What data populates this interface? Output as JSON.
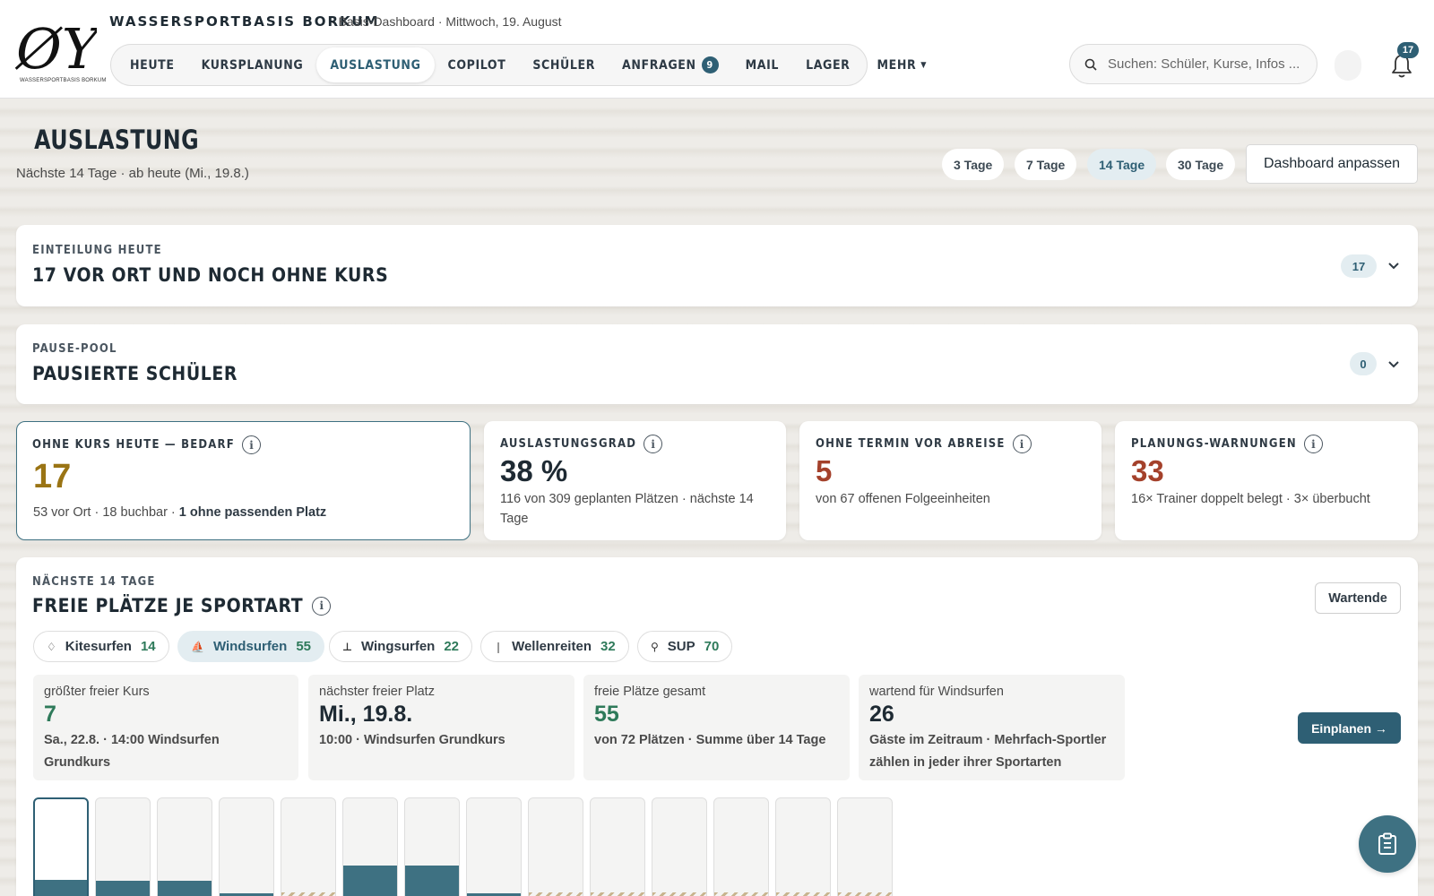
{
  "header": {
    "brand": "WASSERSPORTBASIS BORKUM",
    "subtitle": "· Basis-Dashboard · Mittwoch, 19. August",
    "logo_text": "ØY",
    "logo_subtext": "WASSERSPORTBASIS BORKUM",
    "nav": [
      {
        "label": "HEUTE"
      },
      {
        "label": "KURSPLANUNG"
      },
      {
        "label": "AUSLASTUNG",
        "active": true
      },
      {
        "label": "COPILOT"
      },
      {
        "label": "SCHÜLER"
      },
      {
        "label": "ANFRAGEN",
        "badge": "9"
      },
      {
        "label": "MAIL"
      },
      {
        "label": "LAGER"
      },
      {
        "label": "MEHR"
      }
    ],
    "search_placeholder": "Suchen: Schüler, Kurse, Infos ...",
    "notifications": "17"
  },
  "page": {
    "title": "AUSLASTUNG",
    "subtitle": "Nächste 14 Tage · ab heute (Mi., 19.8.)",
    "ranges": [
      "3 Tage",
      "7 Tage",
      "14 Tage",
      "30 Tage"
    ],
    "active_range": "14 Tage",
    "customize": "Dashboard anpassen"
  },
  "einteilung": {
    "eyebrow": "EINTEILUNG HEUTE",
    "title": "17 VOR ORT UND NOCH OHNE KURS",
    "count": "17"
  },
  "pause_pool": {
    "eyebrow": "PAUSE-POOL",
    "title": "PAUSIERTE SCHÜLER",
    "count": "0"
  },
  "kpis": [
    {
      "label": "OHNE KURS HEUTE — BEDARF",
      "value": "17",
      "color": "#9a7414",
      "desc": "53 vor Ort · 18 buchbar · ",
      "desc_bold": "1 ohne passenden Platz"
    },
    {
      "label": "AUSLASTUNGSGRAD",
      "value": "38 %",
      "color": "#1e2a33",
      "desc": "116 von 309 geplanten Plätzen · nächste 14 Tage"
    },
    {
      "label": "OHNE TERMIN VOR ABREISE",
      "value": "5",
      "color": "#a4412b",
      "desc": "von 67 offenen Folgeeinheiten"
    },
    {
      "label": "PLANUNGS-WARNUNGEN",
      "value": "33",
      "color": "#a4412b",
      "desc": "16× Trainer doppelt belegt · 3× überbucht"
    }
  ],
  "sport": {
    "eyebrow": "NÄCHSTE 14 TAGE",
    "title": "FREIE PLÄTZE JE SPORTART",
    "waiting_button": "Wartende",
    "chips": [
      {
        "label": "Kitesurfen",
        "count": "14",
        "icon": "kite-icon"
      },
      {
        "label": "Windsurfen",
        "count": "55",
        "icon": "windsurf-icon",
        "active": true
      },
      {
        "label": "Wingsurfen",
        "count": "22",
        "icon": "wing-icon"
      },
      {
        "label": "Wellenreiten",
        "count": "32",
        "icon": "surfboard-icon"
      },
      {
        "label": "SUP",
        "count": "70",
        "icon": "sup-icon"
      }
    ],
    "stats": [
      {
        "label": "größter freier Kurs",
        "value": "7",
        "color": "#2e7a5a",
        "desc": "Sa., 22.8. · 14:00 Windsurfen Grundkurs"
      },
      {
        "label": "nächster freier Platz",
        "value": "Mi., 19.8.",
        "color": "#1e2a33",
        "desc": "10:00 · Windsurfen Grundkurs"
      },
      {
        "label": "freie Plätze gesamt",
        "value": "55",
        "color": "#2e7a5a",
        "desc": "von 72 Plätzen · Summe über 14 Tage"
      },
      {
        "label": "wartend für Windsurfen",
        "value": "26",
        "color": "#1e2a33",
        "desc": "Gäste im Zeitraum · Mehrfach-Sportler zählen in jeder ihrer Sportarten"
      }
    ],
    "plan_button": "Einplanen →",
    "day_bars": [
      {
        "free_level": 0.22,
        "none": false,
        "selected": true
      },
      {
        "free_level": 0.22,
        "none": false
      },
      {
        "free_level": 0.22,
        "none": false
      },
      {
        "free_level": 0.1,
        "none": false
      },
      {
        "free_level": 0,
        "none": true
      },
      {
        "free_level": 0.36,
        "none": false
      },
      {
        "free_level": 0.36,
        "none": false
      },
      {
        "free_level": 0.1,
        "none": false
      },
      {
        "free_level": 0,
        "none": true
      },
      {
        "free_level": 0,
        "none": true
      },
      {
        "free_level": 0,
        "none": true
      },
      {
        "free_level": 0,
        "none": true
      },
      {
        "free_level": 0,
        "none": true
      },
      {
        "free_level": 0,
        "none": true
      }
    ]
  },
  "colors": {
    "accent": "#2e5f74",
    "warning": "#9a7414",
    "danger": "#a4412b",
    "success": "#2e7a5a"
  }
}
